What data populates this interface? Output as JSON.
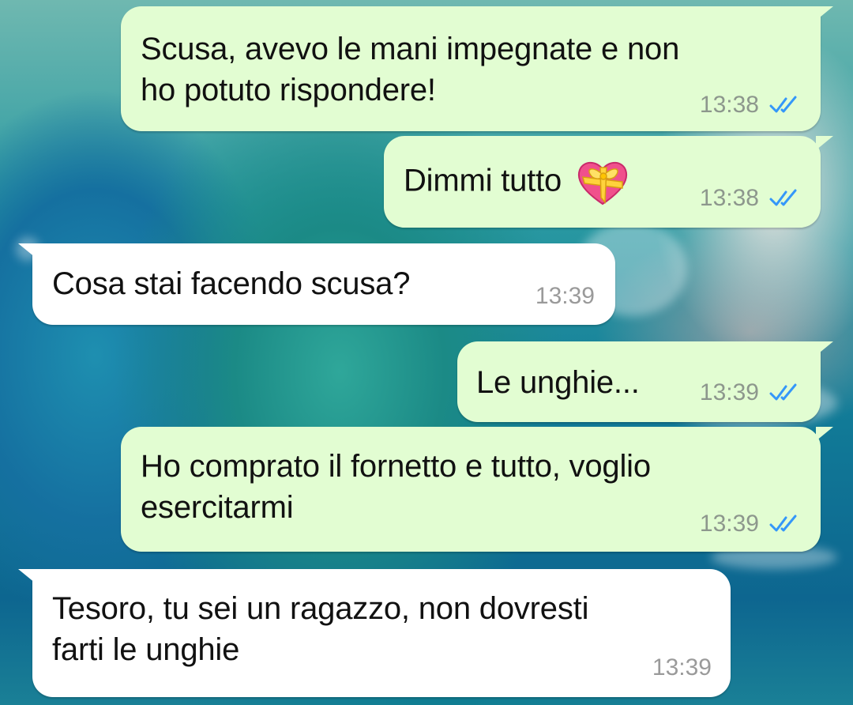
{
  "chat": {
    "messages": [
      {
        "direction": "outgoing",
        "lines": [
          "Scusa, avevo le mani impegnate e non",
          "ho potuto rispondere!"
        ],
        "time": "13:38",
        "status": "read"
      },
      {
        "direction": "outgoing",
        "lines": [
          "Dimmi tutto"
        ],
        "emoji": "heart-with-ribbon",
        "time": "13:38",
        "status": "read"
      },
      {
        "direction": "incoming",
        "lines": [
          "Cosa stai facendo scusa?"
        ],
        "time": "13:39"
      },
      {
        "direction": "outgoing",
        "lines": [
          "Le unghie..."
        ],
        "time": "13:39",
        "status": "read"
      },
      {
        "direction": "outgoing",
        "lines": [
          "Ho comprato il fornetto e tutto, voglio",
          "esercitarmi"
        ],
        "time": "13:39",
        "status": "read"
      },
      {
        "direction": "incoming",
        "lines": [
          "Tesoro, tu sei un ragazzo, non dovresti",
          "farti le unghie"
        ],
        "time": "13:39"
      }
    ]
  },
  "colors": {
    "outgoing_bubble": "#e2fdd2",
    "incoming_bubble": "#ffffff",
    "read_ticks": "#3497f9",
    "timestamp": "#8d978d"
  },
  "icons": {
    "read_receipt": "double-check-icon",
    "emoji": "heart-with-ribbon-emoji"
  }
}
